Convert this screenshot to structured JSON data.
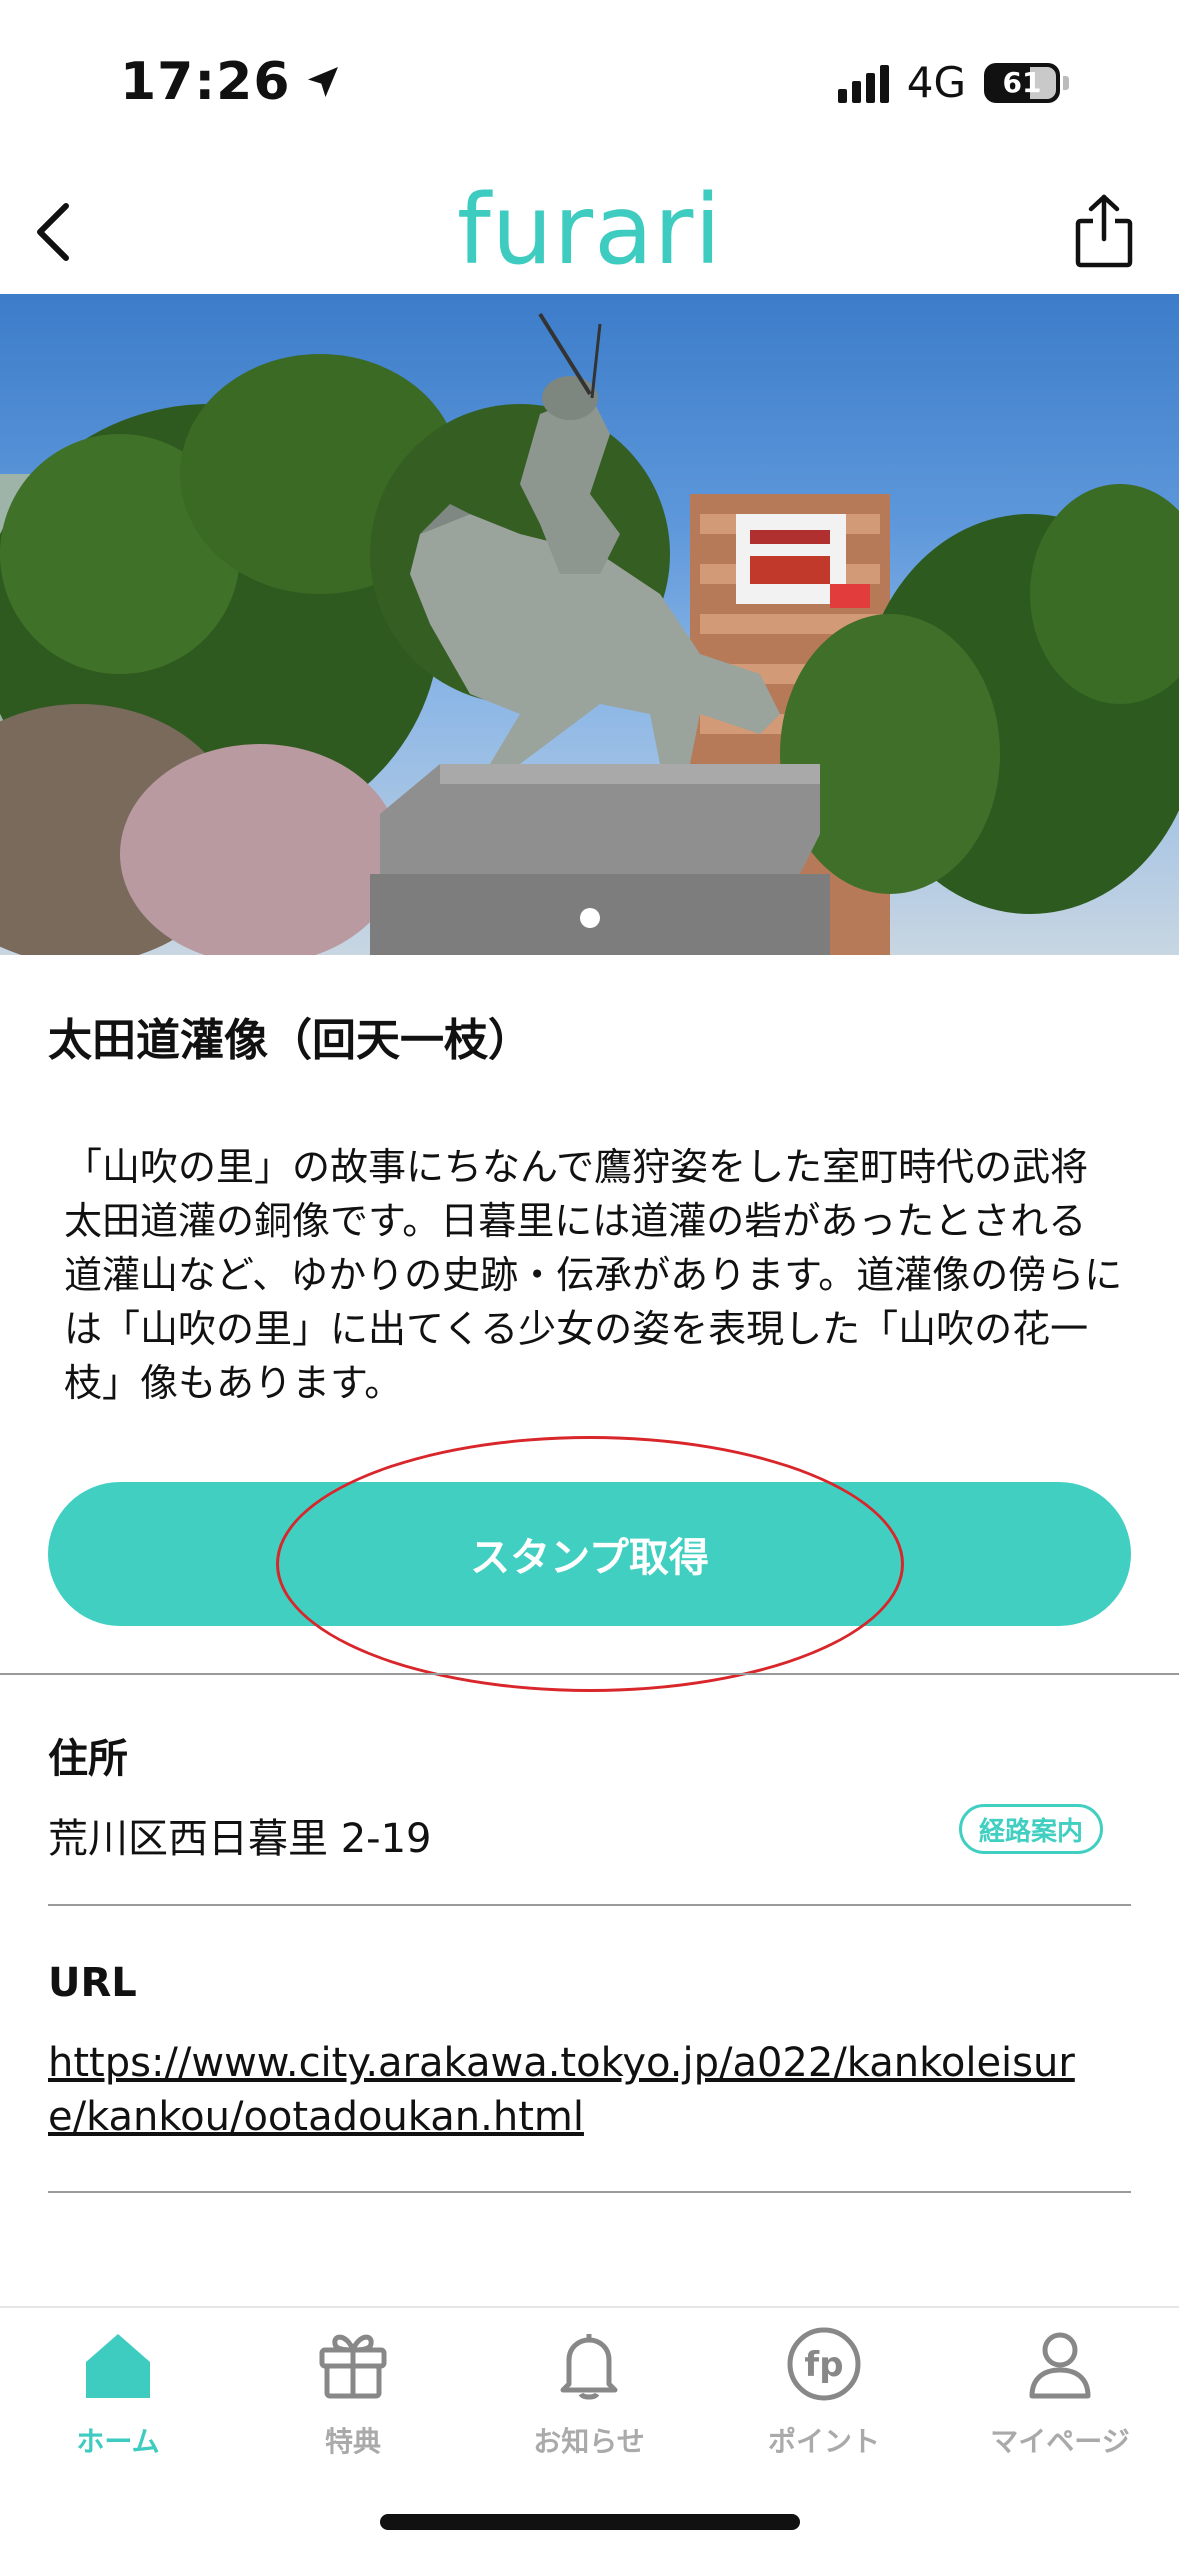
{
  "status_bar": {
    "time": "17:26",
    "network": "4G",
    "battery": "61"
  },
  "header": {
    "logo": "furari",
    "back_icon": "chevron-left-icon",
    "share_icon": "share-icon"
  },
  "spot": {
    "title": "太田道灌像（回天一枝）",
    "description": "「山吹の里」の故事にちなんで鷹狩姿をした室町時代の武将太田道灌の銅像です。日暮里には道灌の砦があったとされる道灌山など、ゆかりの史跡・伝承があります。道灌像の傍らには「山吹の里」に出てくる少女の姿を表現した「山吹の花一枝」像もあります。",
    "stamp_button": "スタンプ取得",
    "address_label": "住所",
    "address_value": "荒川区西日暮里 2-19",
    "route_label": "経路案内",
    "url_label": "URL",
    "url_value": "https://www.city.arakawa.tokyo.jp/a022/kankoleisure/kankou/ootadoukan.html"
  },
  "bottom_nav": {
    "items": [
      {
        "label": "ホーム",
        "icon": "home-icon",
        "active": true
      },
      {
        "label": "特典",
        "icon": "gift-icon",
        "active": false
      },
      {
        "label": "お知らせ",
        "icon": "bell-icon",
        "active": false
      },
      {
        "label": "ポイント",
        "icon": "points-icon",
        "active": false
      },
      {
        "label": "マイページ",
        "icon": "user-icon",
        "active": false
      }
    ]
  },
  "colors": {
    "accent": "#41cfc2",
    "annotation": "#d8262b"
  }
}
